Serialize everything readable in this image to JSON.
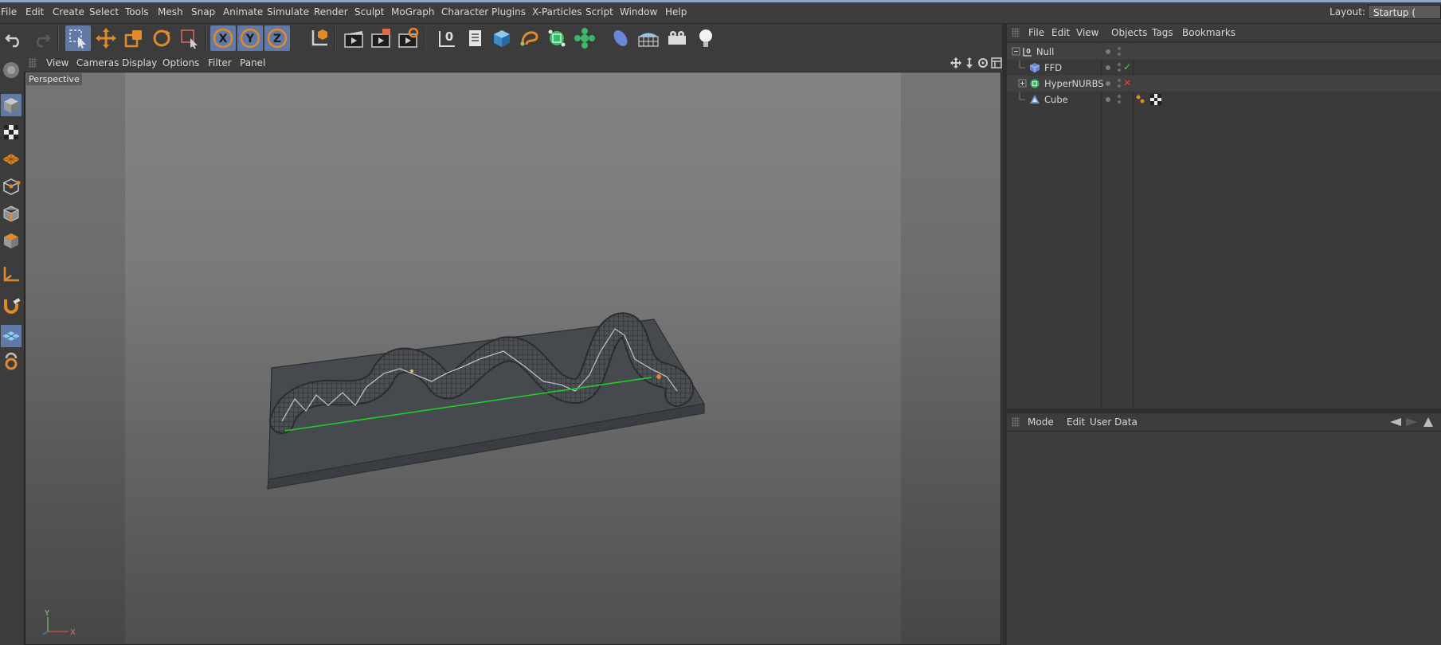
{
  "menubar": {
    "items": [
      "File",
      "Edit",
      "Create",
      "Select",
      "Tools",
      "Mesh",
      "Snap",
      "Animate",
      "Simulate",
      "Render",
      "Sculpt",
      "MoGraph",
      "Character",
      "Plugins",
      "X-Particles",
      "Script",
      "Window",
      "Help"
    ],
    "layout_label": "Layout:",
    "layout_value": "Startup ("
  },
  "toolbar": {
    "buttons": [
      "undo-icon",
      "redo-icon",
      "live-selection-icon",
      "move-icon",
      "scale-icon",
      "rotate-icon",
      "recent-tool-icon",
      "x-axis-lock-icon",
      "y-axis-lock-icon",
      "z-axis-lock-icon",
      "coordinate-system-icon",
      "render-view-icon",
      "render-picture-viewer-icon",
      "edit-render-settings-icon",
      "null-object-icon",
      "spline-icon",
      "cube-primitive-icon",
      "generator-icon",
      "subdivision-icon",
      "array-icon",
      "deformer-icon",
      "floor-icon",
      "camera-icon",
      "light-icon"
    ],
    "axis_labels": {
      "x": "X",
      "y": "Y",
      "z": "Z"
    },
    "null_label": "0"
  },
  "viewport": {
    "menus": [
      "View",
      "Cameras",
      "Display",
      "Options",
      "Filter",
      "Panel"
    ],
    "label": "Perspective",
    "axis": {
      "x": "X",
      "y": "Y"
    }
  },
  "object_manager": {
    "menus": [
      "File",
      "Edit",
      "View",
      "Objects",
      "Tags",
      "Bookmarks"
    ],
    "objects": [
      {
        "name": "Null",
        "indent": 0,
        "status": "",
        "expand": "-"
      },
      {
        "name": "FFD",
        "indent": 1,
        "status": "enabled",
        "expand": ""
      },
      {
        "name": "HyperNURBS",
        "indent": 1,
        "status": "disabled",
        "expand": "+"
      },
      {
        "name": "Cube",
        "indent": 1,
        "status": "",
        "expand": ""
      }
    ],
    "status_symbols": {
      "enabled": "✓",
      "disabled": "✕"
    }
  },
  "attribute_manager": {
    "menus": [
      "Mode",
      "Edit",
      "User Data"
    ]
  },
  "colors": {
    "accent": "#6079a6",
    "tool_orange": "#e08a2a",
    "spline_green": "#21d321",
    "check_green": "#47d147",
    "cross_red": "#e04040"
  }
}
